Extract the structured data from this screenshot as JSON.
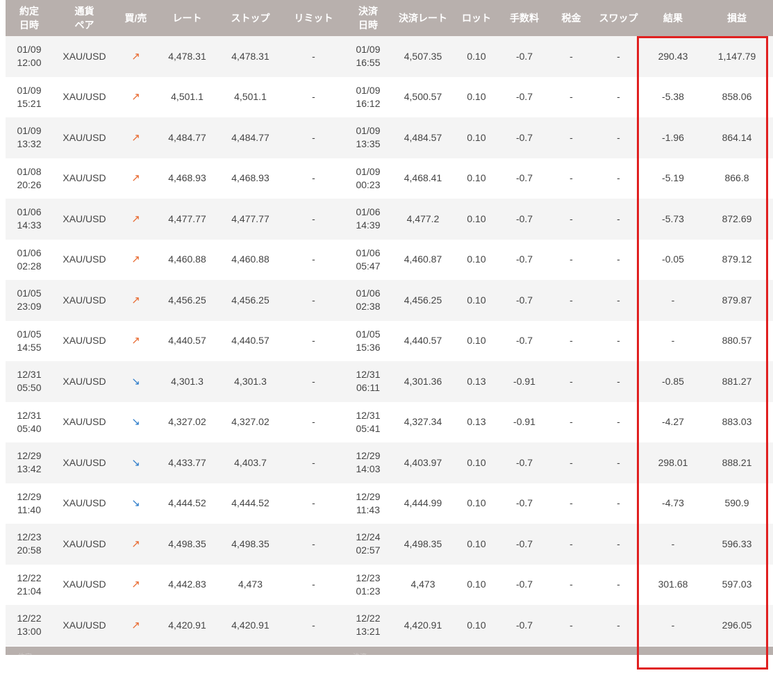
{
  "headers": [
    {
      "line1": "約定",
      "line2": "日時"
    },
    {
      "line1": "通貨",
      "line2": "ペア"
    },
    {
      "line1": "買/売",
      "line2": ""
    },
    {
      "line1": "レート",
      "line2": ""
    },
    {
      "line1": "ストップ",
      "line2": ""
    },
    {
      "line1": "リミット",
      "line2": ""
    },
    {
      "line1": "決済",
      "line2": "日時"
    },
    {
      "line1": "決済レート",
      "line2": ""
    },
    {
      "line1": "ロット",
      "line2": ""
    },
    {
      "line1": "手数料",
      "line2": ""
    },
    {
      "line1": "税金",
      "line2": ""
    },
    {
      "line1": "スワップ",
      "line2": ""
    },
    {
      "line1": "結果",
      "line2": ""
    },
    {
      "line1": "損益",
      "line2": ""
    }
  ],
  "colors": {
    "header_bg": "#b8b0ad",
    "buy_arrow": "#e8672c",
    "sell_arrow": "#2b7bc9",
    "highlight_box": "#e02020"
  },
  "rows": [
    {
      "open_date": "01/09",
      "open_time": "12:00",
      "pair": "XAU/USD",
      "side": "buy",
      "arrow": "↗",
      "rate": "4,478.31",
      "stop": "4,478.31",
      "limit": "-",
      "close_date": "01/09",
      "close_time": "16:55",
      "close_rate": "4,507.35",
      "lot": "0.10",
      "fee": "-0.7",
      "tax": "-",
      "swap": "-",
      "result": "290.43",
      "pnl": "1,147.79"
    },
    {
      "open_date": "01/09",
      "open_time": "15:21",
      "pair": "XAU/USD",
      "side": "buy",
      "arrow": "↗",
      "rate": "4,501.1",
      "stop": "4,501.1",
      "limit": "-",
      "close_date": "01/09",
      "close_time": "16:12",
      "close_rate": "4,500.57",
      "lot": "0.10",
      "fee": "-0.7",
      "tax": "-",
      "swap": "-",
      "result": "-5.38",
      "pnl": "858.06"
    },
    {
      "open_date": "01/09",
      "open_time": "13:32",
      "pair": "XAU/USD",
      "side": "buy",
      "arrow": "↗",
      "rate": "4,484.77",
      "stop": "4,484.77",
      "limit": "-",
      "close_date": "01/09",
      "close_time": "13:35",
      "close_rate": "4,484.57",
      "lot": "0.10",
      "fee": "-0.7",
      "tax": "-",
      "swap": "-",
      "result": "-1.96",
      "pnl": "864.14"
    },
    {
      "open_date": "01/08",
      "open_time": "20:26",
      "pair": "XAU/USD",
      "side": "buy",
      "arrow": "↗",
      "rate": "4,468.93",
      "stop": "4,468.93",
      "limit": "-",
      "close_date": "01/09",
      "close_time": "00:23",
      "close_rate": "4,468.41",
      "lot": "0.10",
      "fee": "-0.7",
      "tax": "-",
      "swap": "-",
      "result": "-5.19",
      "pnl": "866.8"
    },
    {
      "open_date": "01/06",
      "open_time": "14:33",
      "pair": "XAU/USD",
      "side": "buy",
      "arrow": "↗",
      "rate": "4,477.77",
      "stop": "4,477.77",
      "limit": "-",
      "close_date": "01/06",
      "close_time": "14:39",
      "close_rate": "4,477.2",
      "lot": "0.10",
      "fee": "-0.7",
      "tax": "-",
      "swap": "-",
      "result": "-5.73",
      "pnl": "872.69"
    },
    {
      "open_date": "01/06",
      "open_time": "02:28",
      "pair": "XAU/USD",
      "side": "buy",
      "arrow": "↗",
      "rate": "4,460.88",
      "stop": "4,460.88",
      "limit": "-",
      "close_date": "01/06",
      "close_time": "05:47",
      "close_rate": "4,460.87",
      "lot": "0.10",
      "fee": "-0.7",
      "tax": "-",
      "swap": "-",
      "result": "-0.05",
      "pnl": "879.12"
    },
    {
      "open_date": "01/05",
      "open_time": "23:09",
      "pair": "XAU/USD",
      "side": "buy",
      "arrow": "↗",
      "rate": "4,456.25",
      "stop": "4,456.25",
      "limit": "-",
      "close_date": "01/06",
      "close_time": "02:38",
      "close_rate": "4,456.25",
      "lot": "0.10",
      "fee": "-0.7",
      "tax": "-",
      "swap": "-",
      "result": "-",
      "pnl": "879.87"
    },
    {
      "open_date": "01/05",
      "open_time": "14:55",
      "pair": "XAU/USD",
      "side": "buy",
      "arrow": "↗",
      "rate": "4,440.57",
      "stop": "4,440.57",
      "limit": "-",
      "close_date": "01/05",
      "close_time": "15:36",
      "close_rate": "4,440.57",
      "lot": "0.10",
      "fee": "-0.7",
      "tax": "-",
      "swap": "-",
      "result": "-",
      "pnl": "880.57"
    },
    {
      "open_date": "12/31",
      "open_time": "05:50",
      "pair": "XAU/USD",
      "side": "sell",
      "arrow": "↘",
      "rate": "4,301.3",
      "stop": "4,301.3",
      "limit": "-",
      "close_date": "12/31",
      "close_time": "06:11",
      "close_rate": "4,301.36",
      "lot": "0.13",
      "fee": "-0.91",
      "tax": "-",
      "swap": "-",
      "result": "-0.85",
      "pnl": "881.27"
    },
    {
      "open_date": "12/31",
      "open_time": "05:40",
      "pair": "XAU/USD",
      "side": "sell",
      "arrow": "↘",
      "rate": "4,327.02",
      "stop": "4,327.02",
      "limit": "-",
      "close_date": "12/31",
      "close_time": "05:41",
      "close_rate": "4,327.34",
      "lot": "0.13",
      "fee": "-0.91",
      "tax": "-",
      "swap": "-",
      "result": "-4.27",
      "pnl": "883.03"
    },
    {
      "open_date": "12/29",
      "open_time": "13:42",
      "pair": "XAU/USD",
      "side": "sell",
      "arrow": "↘",
      "rate": "4,433.77",
      "stop": "4,403.7",
      "limit": "-",
      "close_date": "12/29",
      "close_time": "14:03",
      "close_rate": "4,403.97",
      "lot": "0.10",
      "fee": "-0.7",
      "tax": "-",
      "swap": "-",
      "result": "298.01",
      "pnl": "888.21"
    },
    {
      "open_date": "12/29",
      "open_time": "11:40",
      "pair": "XAU/USD",
      "side": "sell",
      "arrow": "↘",
      "rate": "4,444.52",
      "stop": "4,444.52",
      "limit": "-",
      "close_date": "12/29",
      "close_time": "11:43",
      "close_rate": "4,444.99",
      "lot": "0.10",
      "fee": "-0.7",
      "tax": "-",
      "swap": "-",
      "result": "-4.73",
      "pnl": "590.9"
    },
    {
      "open_date": "12/23",
      "open_time": "20:58",
      "pair": "XAU/USD",
      "side": "buy",
      "arrow": "↗",
      "rate": "4,498.35",
      "stop": "4,498.35",
      "limit": "-",
      "close_date": "12/24",
      "close_time": "02:57",
      "close_rate": "4,498.35",
      "lot": "0.10",
      "fee": "-0.7",
      "tax": "-",
      "swap": "-",
      "result": "-",
      "pnl": "596.33"
    },
    {
      "open_date": "12/22",
      "open_time": "21:04",
      "pair": "XAU/USD",
      "side": "buy",
      "arrow": "↗",
      "rate": "4,442.83",
      "stop": "4,473",
      "limit": "-",
      "close_date": "12/23",
      "close_time": "01:23",
      "close_rate": "4,473",
      "lot": "0.10",
      "fee": "-0.7",
      "tax": "-",
      "swap": "-",
      "result": "301.68",
      "pnl": "597.03"
    },
    {
      "open_date": "12/22",
      "open_time": "13:00",
      "pair": "XAU/USD",
      "side": "buy",
      "arrow": "↗",
      "rate": "4,420.91",
      "stop": "4,420.91",
      "limit": "-",
      "close_date": "12/22",
      "close_time": "13:21",
      "close_rate": "4,420.91",
      "lot": "0.10",
      "fee": "-0.7",
      "tax": "-",
      "swap": "-",
      "result": "-",
      "pnl": "296.05"
    }
  ],
  "footer": {
    "left_fragment": "約定",
    "right_fragment": "決済"
  }
}
